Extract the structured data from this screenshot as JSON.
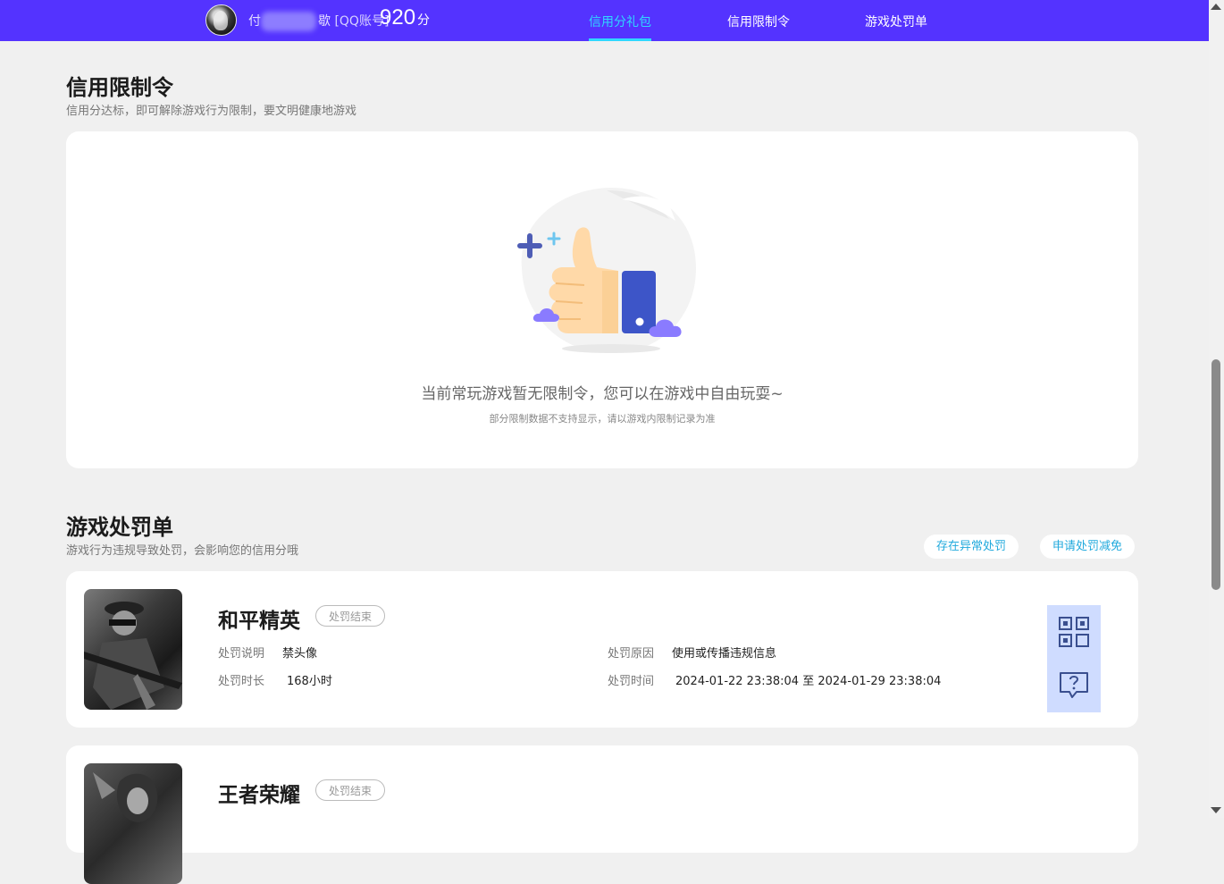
{
  "header": {
    "username_visible": "付",
    "username_tail": "歇",
    "account_type": "[QQ账号]",
    "score": "920",
    "score_unit": "分",
    "nav": [
      {
        "label": "信用分礼包",
        "active": true
      },
      {
        "label": "信用限制令",
        "active": false
      },
      {
        "label": "游戏处罚单",
        "active": false
      }
    ],
    "accent_color": "#5433ff",
    "active_color": "#2fd8ff"
  },
  "restriction": {
    "title": "信用限制令",
    "subtitle": "信用分达标，即可解除游戏行为限制，要文明健康地游戏",
    "empty_message": "当前常玩游戏暂无限制令，您可以在游戏中自由玩耍~",
    "empty_note": "部分限制数据不支持显示，请以游戏内限制记录为准"
  },
  "penalty": {
    "title": "游戏处罚单",
    "subtitle": "游戏行为违规导致处罚，会影响您的信用分哦",
    "btn_abnormal": "存在异常处罚",
    "btn_appeal": "申请处罚减免",
    "items": [
      {
        "game": "和平精英",
        "status": "处罚结束",
        "desc_label": "处罚说明",
        "desc": "禁头像",
        "duration_label": "处罚时长",
        "duration": "168小时",
        "reason_label": "处罚原因",
        "reason": "使用或传播违规信息",
        "time_label": "处罚时间",
        "time": "2024-01-22 23:38:04 至 2024-01-29 23:38:04"
      },
      {
        "game": "王者荣耀",
        "status": "处罚结束"
      }
    ]
  }
}
